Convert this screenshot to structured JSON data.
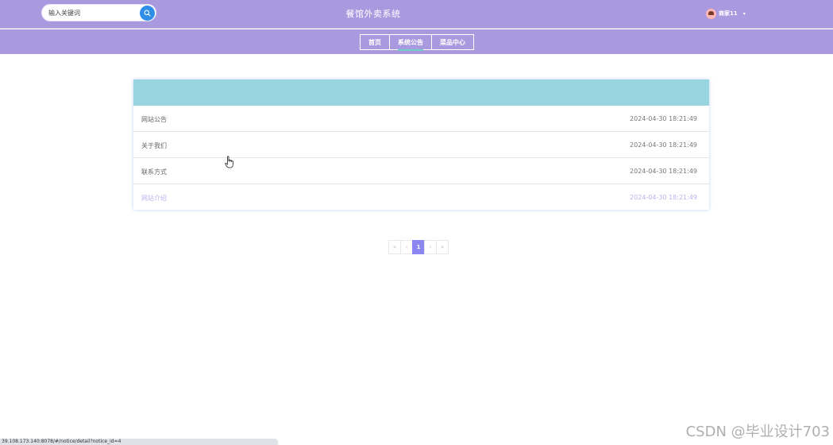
{
  "header": {
    "search_placeholder": "输入关键词",
    "site_title": "餐馆外卖系统",
    "user_name": "商家11",
    "caret": "▾"
  },
  "nav": [
    {
      "label": "首页",
      "active": false
    },
    {
      "label": "系统公告",
      "active": true
    },
    {
      "label": "菜品中心",
      "active": false
    }
  ],
  "notices": [
    {
      "title": "网站公告",
      "date": "2024-04-30 18:21:49"
    },
    {
      "title": "关于我们",
      "date": "2024-04-30 18:21:49"
    },
    {
      "title": "联系方式",
      "date": "2024-04-30 18:21:49"
    },
    {
      "title": "网站介绍",
      "date": "2024-04-30 18:21:49"
    }
  ],
  "pagination": {
    "first": "«",
    "prev": "‹",
    "current": "1",
    "next": "›",
    "last": "»"
  },
  "status_url": "39.108.173.140:8078/#/notice/detail?notice_id=4",
  "watermark": "CSDN @毕业设计703",
  "colors": {
    "header_bg": "#a99ae0",
    "panel_head": "#99d5e0",
    "pager_active": "#8c86f2",
    "search_button": "#2f8fe8"
  },
  "icons": {
    "search": "search-icon",
    "cursor": "hand-pointer-icon"
  }
}
